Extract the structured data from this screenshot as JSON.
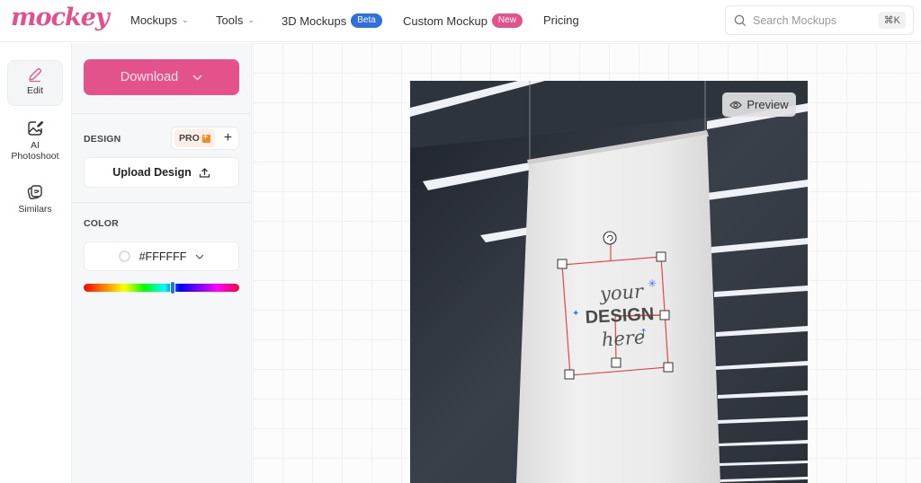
{
  "brand": {
    "logo_text": "mockey",
    "accent": "#e4528c"
  },
  "nav": {
    "items": [
      {
        "label": "Mockups",
        "has_dropdown": true
      },
      {
        "label": "Tools",
        "has_dropdown": true
      },
      {
        "label": "3D Mockups",
        "badge": "Beta",
        "badge_color": "#2f6fe0"
      },
      {
        "label": "Custom Mockup",
        "badge": "New",
        "badge_color": "#e4528c"
      },
      {
        "label": "Pricing"
      }
    ]
  },
  "search": {
    "placeholder": "Search Mockups",
    "shortcut": "⌘K"
  },
  "rail": {
    "items": [
      {
        "label": "Edit",
        "icon": "pencil-icon",
        "active": true
      },
      {
        "label": "AI Photoshoot",
        "icon": "image-edit-icon"
      },
      {
        "label": "Similars",
        "icon": "stack-icon"
      }
    ]
  },
  "panel": {
    "download_label": "Download",
    "design": {
      "label": "DESIGN",
      "pro_label": "PRO",
      "upload_label": "Upload Design"
    },
    "color": {
      "label": "COLOR",
      "value": "#FFFFFF",
      "hue_position": 0.57
    }
  },
  "canvas": {
    "preview_label": "Preview",
    "placeholder": {
      "line1": "your",
      "line2": "DESIGN",
      "line3": "here"
    }
  }
}
